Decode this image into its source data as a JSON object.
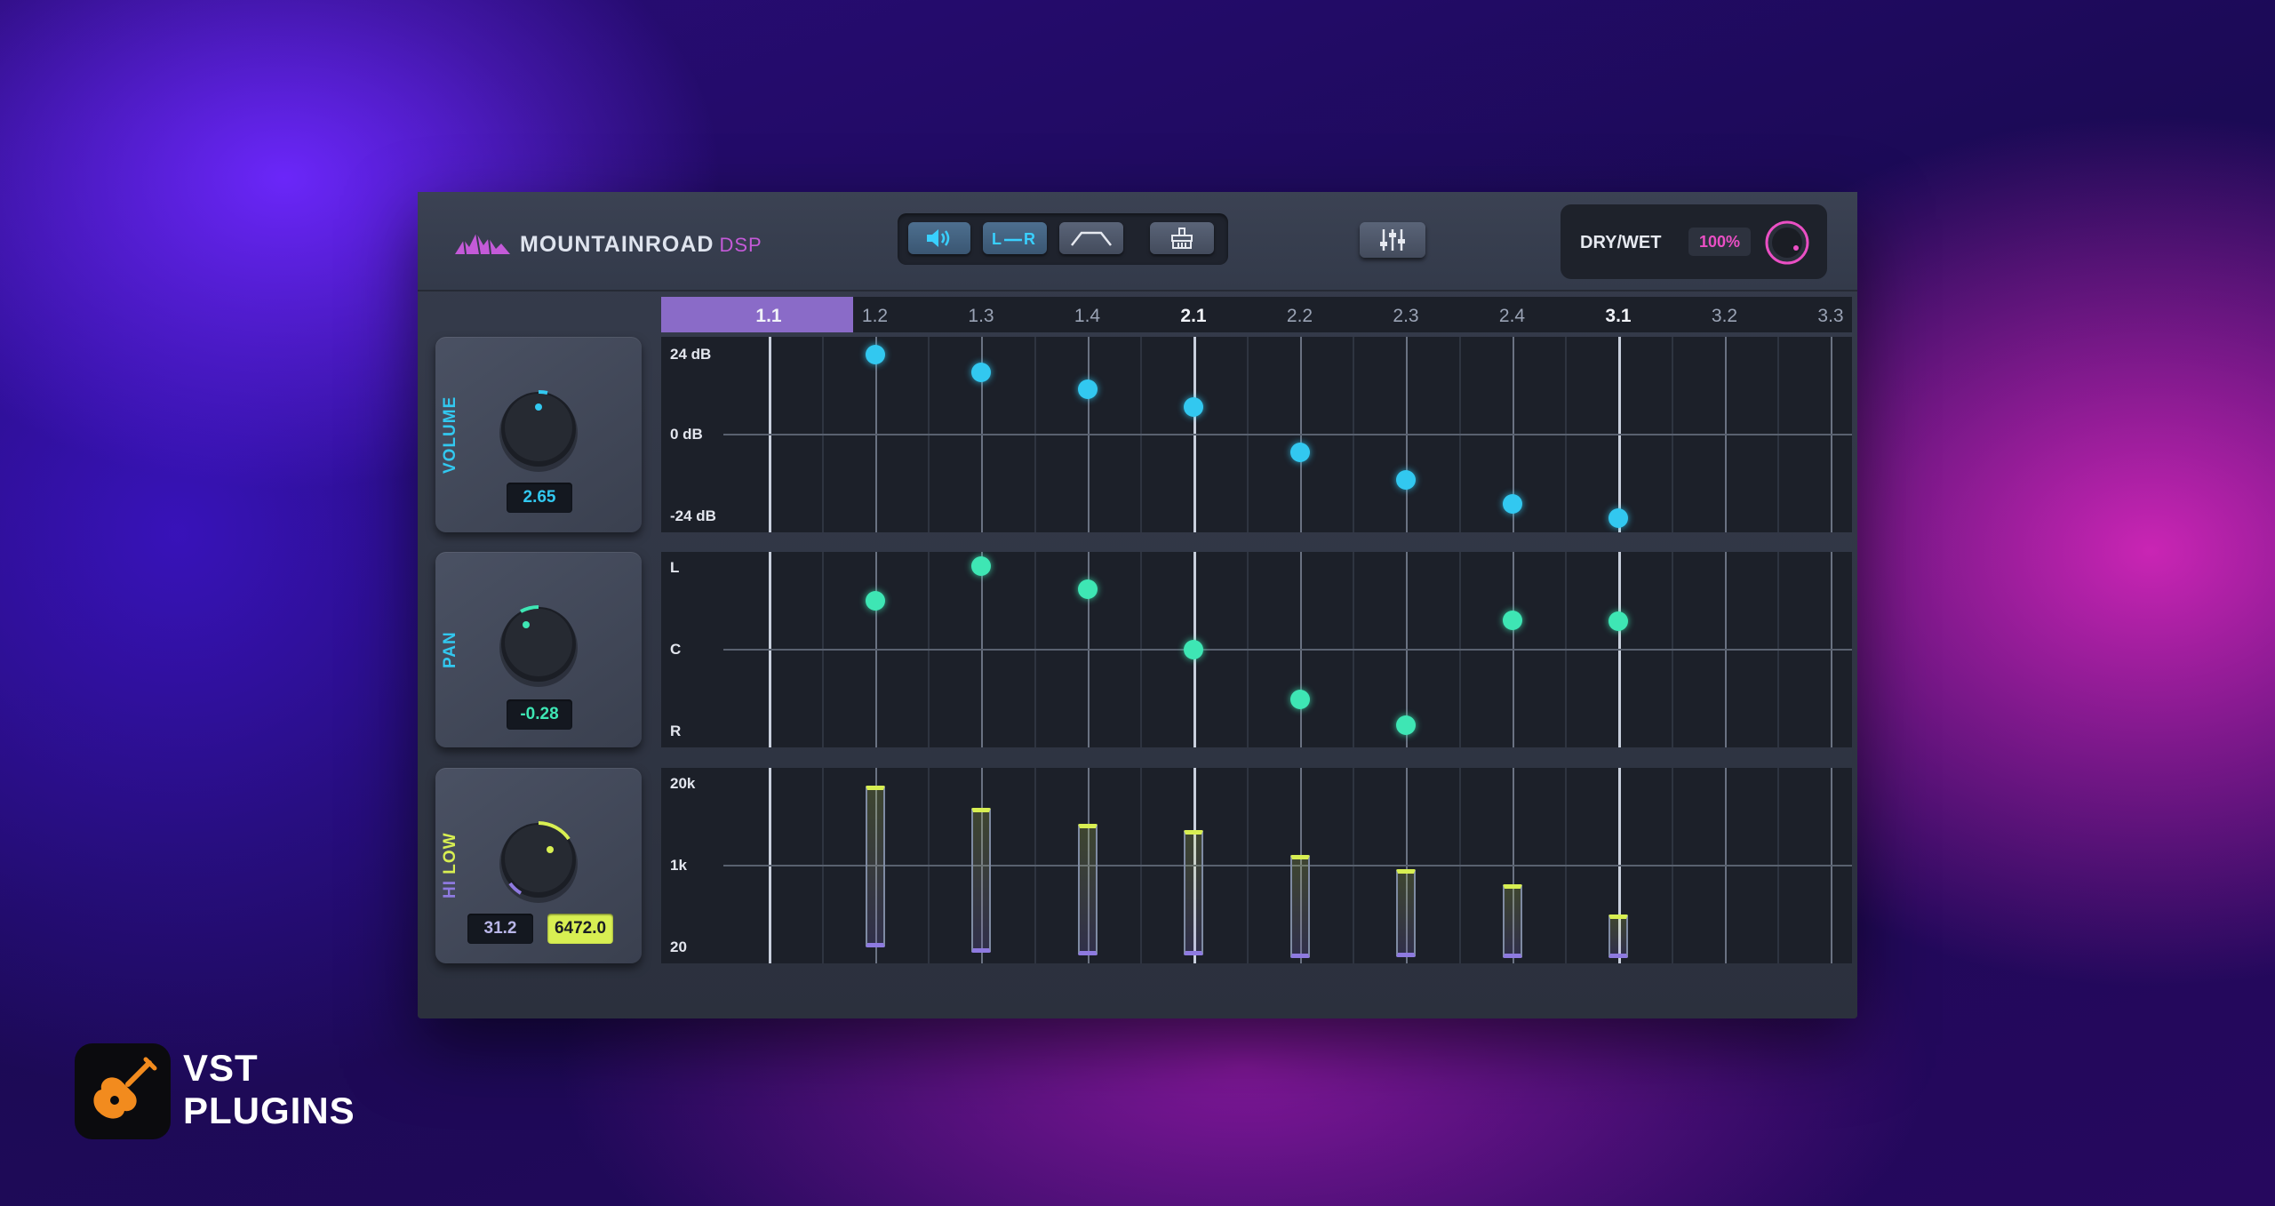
{
  "plugin": {
    "brand_name": "MOUNTAINROAD",
    "brand_suffix": "DSP",
    "drywet": {
      "label": "DRY/WET",
      "value": "100%"
    }
  },
  "toolbar": {
    "buttons": [
      {
        "icon": "speaker-icon",
        "active": true
      },
      {
        "label": "L R",
        "icon": "lr-link-icon",
        "active": true
      },
      {
        "icon": "filter-shape-icon",
        "active": false
      },
      {
        "icon": "brush-icon",
        "active": false
      }
    ],
    "mixer_icon": "sliders-icon"
  },
  "panels": {
    "volume": {
      "label": "VOLUME",
      "value": "2.65",
      "color": "#32c8f0"
    },
    "pan": {
      "label": "PAN",
      "value": "-0.28",
      "color": "#3ee6b4"
    },
    "filter": {
      "label_hi": "HI",
      "label_low": "LOW",
      "hi_value": "31.2",
      "low_value": "6472.0",
      "hi_color": "#8e7ae0",
      "low_color": "#d8ef52"
    }
  },
  "timeline": {
    "ticks": [
      "1.1",
      "1.2",
      "1.3",
      "1.4",
      "2.1",
      "2.2",
      "2.3",
      "2.4",
      "3.1",
      "3.2",
      "3.3"
    ],
    "bar_ticks": [
      "1.1",
      "2.1",
      "3.1"
    ],
    "selected_tick": "1.1"
  },
  "lanes": {
    "volume": {
      "labels": [
        "24 dB",
        "0 dB",
        "-24 dB"
      ],
      "points_db": [
        23,
        18,
        13,
        8,
        -5,
        -13,
        -20,
        -24
      ]
    },
    "pan": {
      "labels": [
        "L",
        "C",
        "R"
      ],
      "points": [
        -0.58,
        -1.0,
        -0.72,
        0.0,
        0.6,
        0.9,
        -0.35,
        -0.34
      ]
    },
    "filter": {
      "labels": [
        "20k",
        "1k",
        "20"
      ],
      "points": [
        {
          "hi": 31.2,
          "low": 17000
        },
        {
          "hi": 25,
          "low": 7000
        },
        {
          "hi": 22,
          "low": 3500
        },
        {
          "hi": 22,
          "low": 2800
        },
        {
          "hi": 20,
          "low": 1000
        },
        {
          "hi": 21,
          "low": 540
        },
        {
          "hi": 20,
          "low": 290
        },
        {
          "hi": 20,
          "low": 85
        }
      ]
    }
  },
  "watermark": {
    "line1": "VST",
    "line2": "PLUGINS",
    "icon": "guitar-icon"
  }
}
